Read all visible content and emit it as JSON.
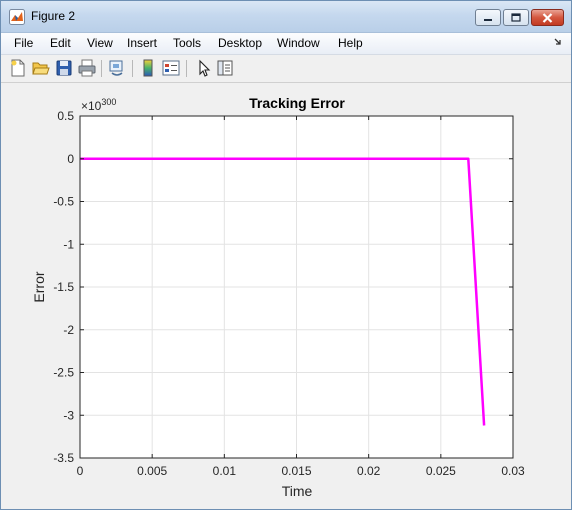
{
  "window": {
    "title": "Figure 2",
    "icon": "matlab-figure-icon",
    "controls": [
      "minimize-icon",
      "maximize-icon",
      "close-icon"
    ]
  },
  "menu": {
    "items": [
      "File",
      "Edit",
      "View",
      "Insert",
      "Tools",
      "Desktop",
      "Window",
      "Help"
    ]
  },
  "toolbar": {
    "buttons": [
      "new-figure-icon",
      "open-file-icon",
      "save-icon",
      "print-icon",
      "link-plot-icon",
      "colorbar-icon",
      "legend-icon",
      "pointer-icon",
      "property-editor-icon"
    ]
  },
  "chart_data": {
    "type": "line",
    "title": "Tracking Error",
    "xlabel": "Time",
    "ylabel": "Error",
    "y_exponent_label": "×10",
    "y_exponent": "300",
    "xlim": [
      0,
      0.03
    ],
    "ylim": [
      -3.5,
      0.5
    ],
    "xticks": [
      0,
      0.005,
      0.01,
      0.015,
      0.02,
      0.025,
      0.03
    ],
    "xtick_labels": [
      "0",
      "0.005",
      "0.01",
      "0.015",
      "0.02",
      "0.025",
      "0.03"
    ],
    "yticks": [
      0.5,
      0,
      -0.5,
      -1,
      -1.5,
      -2,
      -2.5,
      -3,
      -3.5
    ],
    "ytick_labels": [
      "0.5",
      "0",
      "-0.5",
      "-1",
      "-1.5",
      "-2",
      "-2.5",
      "-3",
      "-3.5"
    ],
    "grid": true,
    "series": [
      {
        "color": "#ff00ff",
        "x": [
          0,
          0.005,
          0.01,
          0.015,
          0.02,
          0.025,
          0.0269,
          0.028
        ],
        "y": [
          0,
          0,
          0,
          0,
          0,
          0,
          0,
          -3.12
        ]
      }
    ]
  }
}
